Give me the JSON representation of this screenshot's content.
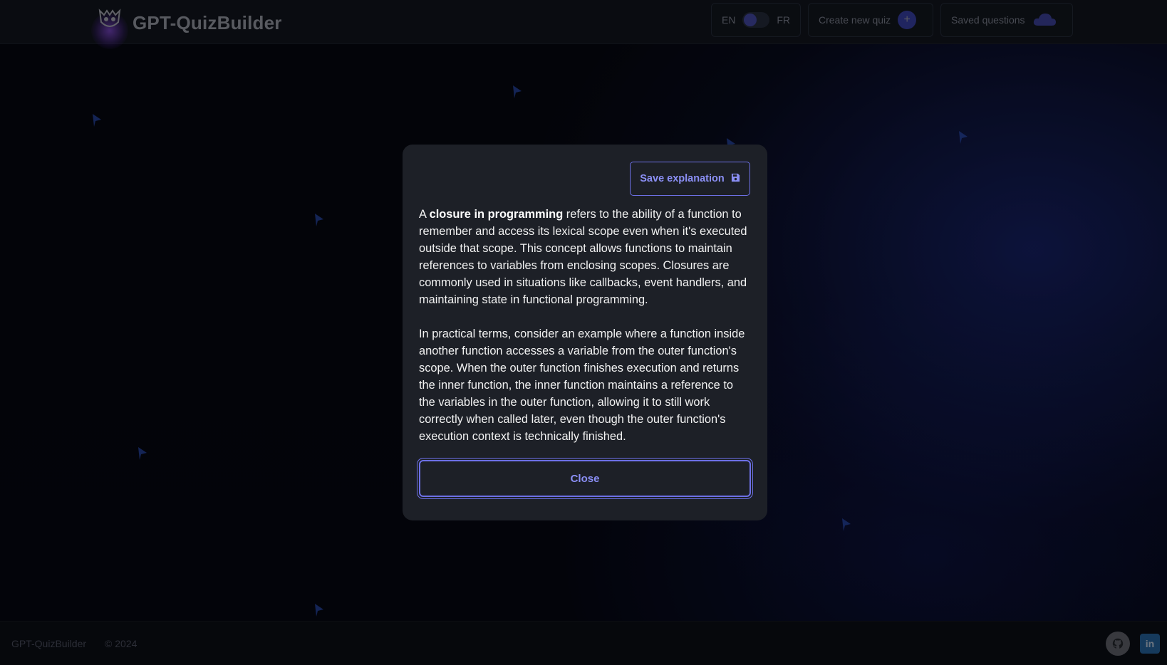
{
  "app": {
    "brand_name": "GPT-QuizBuilder"
  },
  "navbar": {
    "lang_left": "EN",
    "lang_right": "FR",
    "create_label": "Create new quiz",
    "saved_label": "Saved questions"
  },
  "modal": {
    "save_label": "Save explanation",
    "paragraph1_pre": "A ",
    "paragraph1_bold": "closure in programming",
    "paragraph1_post": " refers to the ability of a function to remember and access its lexical scope even when it's executed outside that scope. This concept allows functions to maintain references to variables from enclosing scopes. Closures are commonly used in situations like callbacks, event handlers, and maintaining state in functional programming.",
    "paragraph2": "In practical terms, consider an example where a function inside another function accesses a variable from the outer function's scope. When the outer function finishes execution and returns the inner function, the inner function maintains a reference to the variables in the outer function, allowing it to still work correctly when called later, even though the outer function's execution context is technically finished.",
    "close_label": "Close"
  },
  "footer": {
    "brand": "GPT-QuizBuilder",
    "copyright": "© 2024"
  },
  "icons": {
    "logo": "owl-logo-icon",
    "save": "save-icon",
    "create": "plus-circle-icon",
    "saved": "cloud-icon",
    "github": "github-icon",
    "linkedin": "linkedin-icon"
  },
  "colors": {
    "accent": "#6d70e6",
    "accent_text": "#8b8ff5",
    "modal_bg": "#1d2027"
  }
}
